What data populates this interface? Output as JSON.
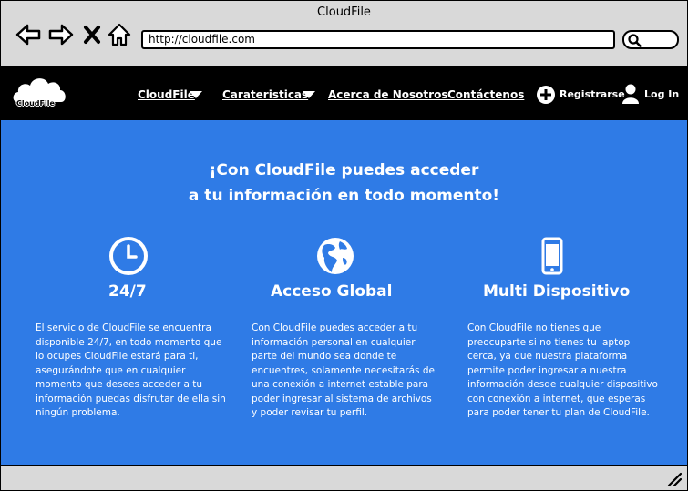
{
  "window": {
    "title": "CloudFile"
  },
  "browser": {
    "url": "http://cloudfile.com",
    "search_value": ""
  },
  "navbar": {
    "logo_text": "CloudFile",
    "items": [
      {
        "label": "CloudFile",
        "has_dropdown": true
      },
      {
        "label": "Carateristicas",
        "has_dropdown": true
      },
      {
        "label": "Acerca de Nosotros",
        "has_dropdown": false
      },
      {
        "label": "Contáctenos",
        "has_dropdown": false
      }
    ],
    "register_label": "Registrarse",
    "login_label": "Log In"
  },
  "hero": {
    "headline_line1": "¡Con CloudFile puedes acceder",
    "headline_line2": "a tu información en todo momento!",
    "features": [
      {
        "icon": "clock-icon",
        "title": "24/7",
        "text": "El servicio de CloudFile se encuentra disponible 24/7, en todo momento que lo ocupes CloudFile estará para ti, asegurándote que en cualquier momento que desees acceder a tu información puedas disfrutar de ella sin ningún problema."
      },
      {
        "icon": "globe-icon",
        "title": "Acceso Global",
        "text": "Con CloudFile puedes acceder a tu información personal en cualquier parte del mundo sea donde te encuentres, solamente necesitarás de una conexión a internet estable para poder ingresar al sistema de archivos y poder revisar tu perfil."
      },
      {
        "icon": "smartphone-icon",
        "title": "Multi Dispositivo",
        "text": "Con CloudFile no tienes que preocuparte si no tienes tu laptop cerca, ya que nuestra plataforma permite poder ingresar a nuestra información desde cualquier dispositivo con conexión a internet, que esperas para poder tener tu plan de CloudFile."
      }
    ]
  },
  "colors": {
    "hero_background": "#2f7be6",
    "navbar_background": "#000000",
    "chrome_background": "#d9d9d9"
  }
}
